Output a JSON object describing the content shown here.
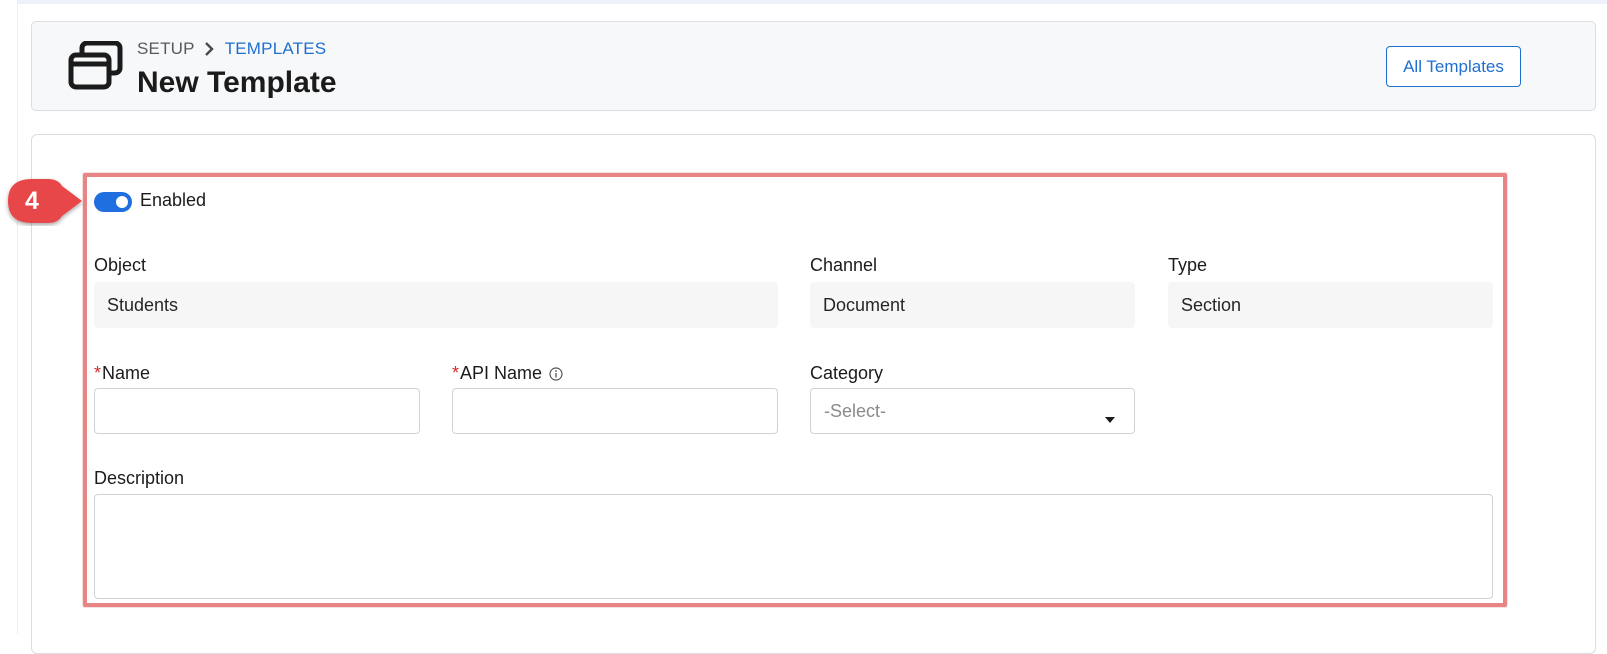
{
  "breadcrumb": {
    "setup": "SETUP",
    "templates": "TEMPLATES"
  },
  "page": {
    "title": "New Template",
    "all_templates_button": "All Templates"
  },
  "annotation": {
    "step_number": "4",
    "badge_color": "#e8474a",
    "highlight_color": "#e78585"
  },
  "form": {
    "enabled_toggle": {
      "label": "Enabled",
      "checked": true
    },
    "object": {
      "label": "Object",
      "value": "Students"
    },
    "channel": {
      "label": "Channel",
      "value": "Document"
    },
    "type": {
      "label": "Type",
      "value": "Section"
    },
    "name": {
      "required_mark": "*",
      "label": "Name",
      "value": ""
    },
    "api_name": {
      "required_mark": "*",
      "label": "API Name",
      "value": "",
      "info_icon": "info-icon"
    },
    "category": {
      "label": "Category",
      "selected": "-Select-"
    },
    "description": {
      "label": "Description",
      "value": ""
    }
  },
  "colors": {
    "accent": "#1f6fd1",
    "toggle_on": "#1f6fe0",
    "required": "#d12b2b"
  }
}
